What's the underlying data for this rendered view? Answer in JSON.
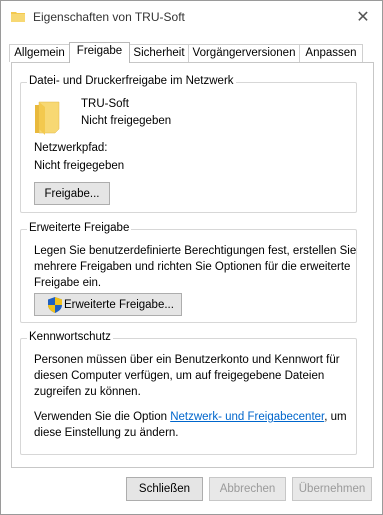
{
  "window": {
    "title": "Eigenschaften von TRU-Soft",
    "close_glyph": "✕"
  },
  "tabs": [
    {
      "label": "Allgemein",
      "active": false
    },
    {
      "label": "Freigabe",
      "active": true
    },
    {
      "label": "Sicherheit",
      "active": false
    },
    {
      "label": "Vorgängerversionen",
      "active": false
    },
    {
      "label": "Anpassen",
      "active": false
    }
  ],
  "sharing": {
    "title": "Datei- und Druckerfreigabe im Netzwerk",
    "folder_name": "TRU-Soft",
    "status": "Nicht freigegeben",
    "path_label": "Netzwerkpfad:",
    "path_value": "Nicht freigegeben",
    "share_button": "Freigabe..."
  },
  "advanced": {
    "title": "Erweiterte Freigabe",
    "description_lines": [
      "Legen Sie benutzerdefinierte Berechtigungen fest, erstellen Sie",
      "mehrere Freigaben und richten Sie Optionen für die erweiterte",
      "Freigabe ein."
    ],
    "button": "Erweiterte Freigabe..."
  },
  "password": {
    "title": "Kennwortschutz",
    "description_lines": [
      "Personen müssen über ein Benutzerkonto und Kennwort für",
      "diesen Computer verfügen, um auf freigegebene Dateien",
      "zugreifen zu können."
    ],
    "change_prefix": "Verwenden Sie die Option ",
    "change_link": "Netzwerk- und Freigabecenter",
    "change_suffix": ", um",
    "change_line2": "diese Einstellung zu ändern."
  },
  "footer": {
    "close_button": "Schließen",
    "cancel_button": "Abbrechen",
    "apply_button": "Übernehmen"
  },
  "colors": {
    "folder": "#f3c94e",
    "link": "#0066cc",
    "shield_blue": "#1f5fbf",
    "shield_yellow": "#f2c21b"
  }
}
